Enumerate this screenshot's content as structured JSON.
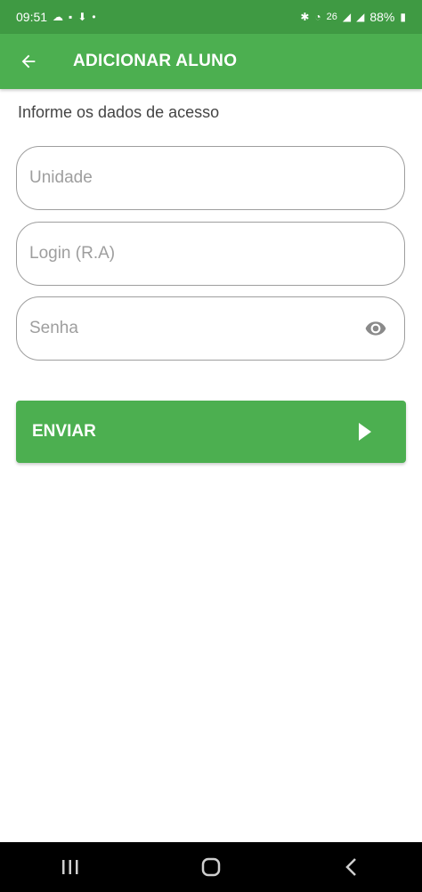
{
  "status_bar": {
    "time": "09:51",
    "network_label": "26",
    "battery": "88%"
  },
  "app_bar": {
    "title": "ADICIONAR ALUNO"
  },
  "form": {
    "section_label": "Informe os dados de acesso",
    "unit_placeholder": "Unidade",
    "login_placeholder": "Login (R.A)",
    "password_placeholder": "Senha",
    "submit_label": "ENVIAR"
  },
  "colors": {
    "primary": "#4caf50",
    "status_bar": "#3f9a43",
    "field_border": "#9e9e9e"
  }
}
